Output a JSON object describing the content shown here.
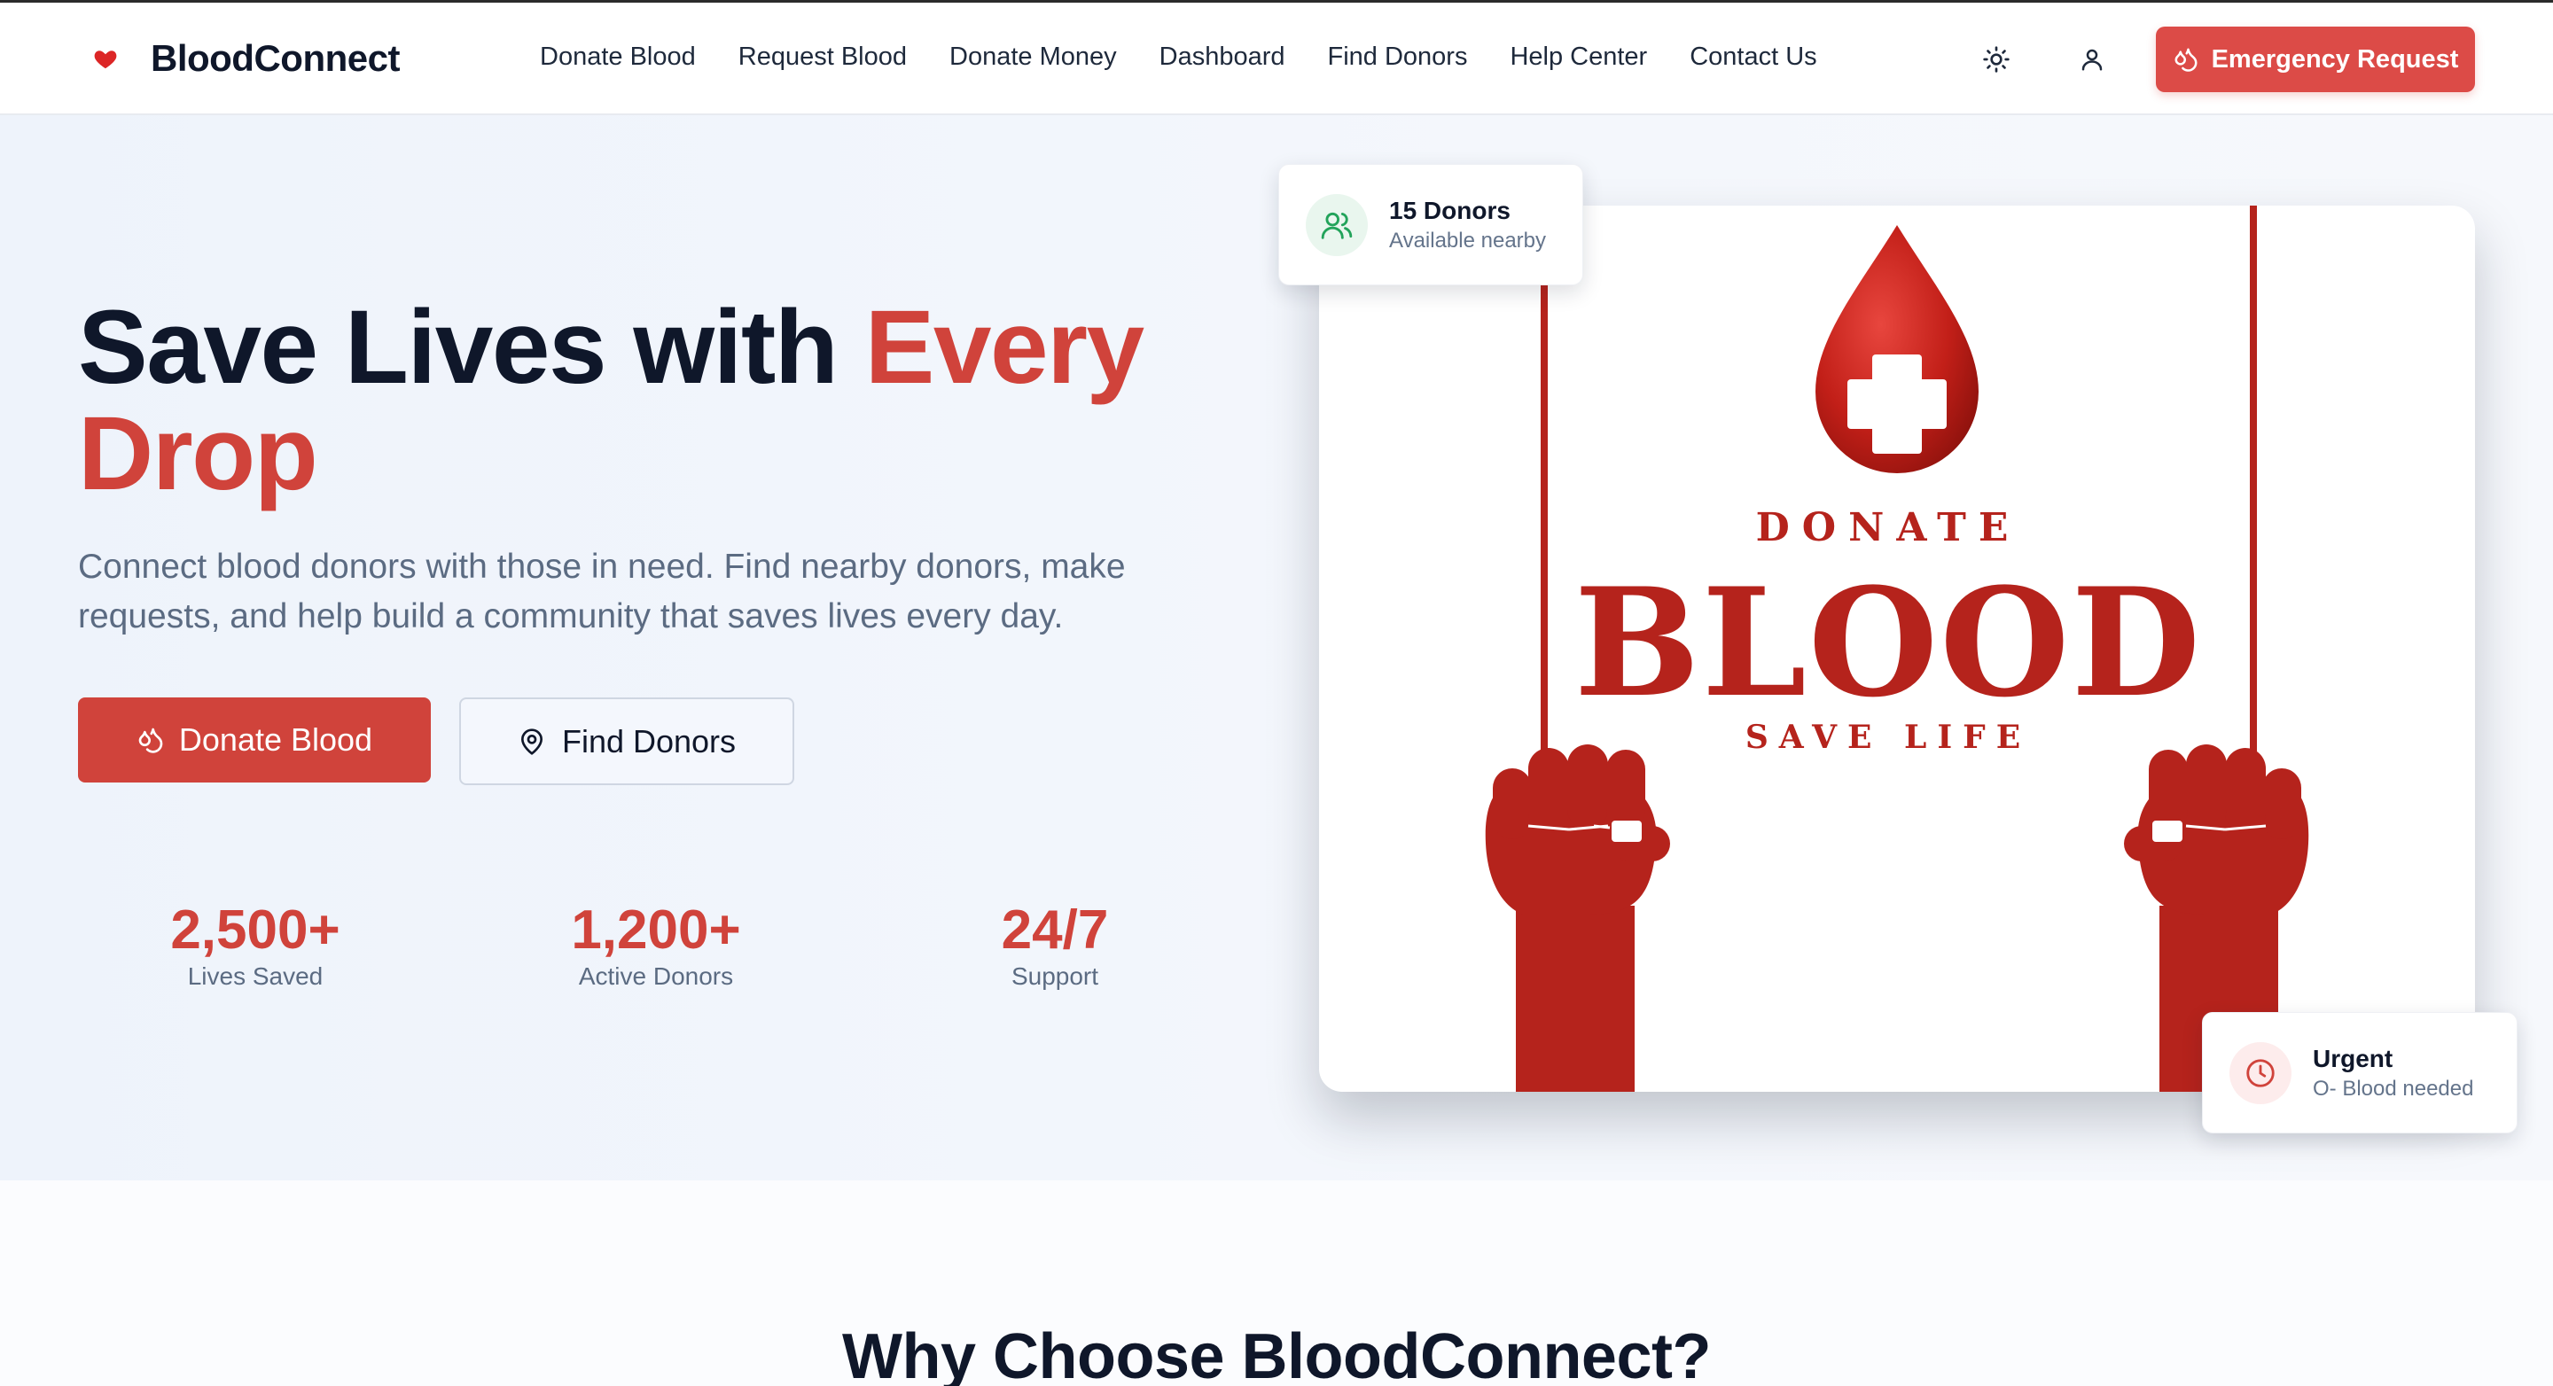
{
  "nav": {
    "brand": "BloodConnect",
    "links": [
      "Donate Blood",
      "Request Blood",
      "Donate Money",
      "Dashboard",
      "Find Donors",
      "Help Center",
      "Contact Us"
    ],
    "emergency_label": "Emergency Request",
    "icons": [
      "heart-icon",
      "sun-icon",
      "user-icon",
      "droplets-icon"
    ]
  },
  "hero": {
    "headline_part1": "Save Lives with ",
    "headline_accent": "Every Drop",
    "subtext": "Connect blood donors with those in need. Find nearby donors, make requests, and help build a community that saves lives every day.",
    "primary_button": "Donate Blood",
    "secondary_button": "Find Donors",
    "stats": [
      {
        "value": "2,500+",
        "label": "Lives Saved"
      },
      {
        "value": "1,200+",
        "label": "Active Donors"
      },
      {
        "value": "24/7",
        "label": "Support"
      }
    ]
  },
  "poster": {
    "top_text": "DONATE",
    "main_text": "BLOOD",
    "bottom_text": "SAVE LIFE"
  },
  "donors_card": {
    "title": "15 Donors",
    "subtitle": "Available nearby"
  },
  "urgent_card": {
    "title": "Urgent",
    "subtitle": "O- Blood needed"
  },
  "section": {
    "title": "Why Choose BloodConnect?"
  },
  "colors": {
    "accent": "#d0433b",
    "emergency": "#dc4b47",
    "poster_red": "#b5231c"
  }
}
